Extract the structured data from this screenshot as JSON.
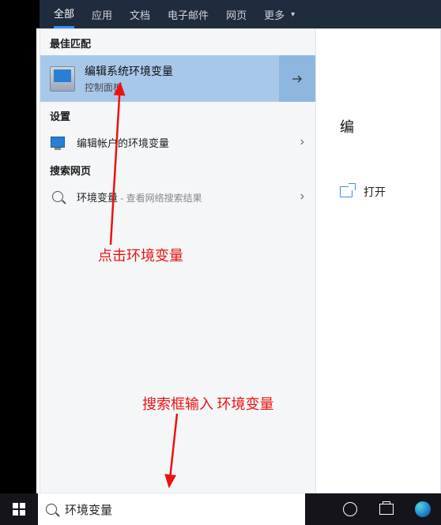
{
  "tabs": {
    "all": "全部",
    "apps": "应用",
    "docs": "文档",
    "email": "电子邮件",
    "web": "网页",
    "more": "更多"
  },
  "sections": {
    "best_match": "最佳匹配",
    "settings": "设置",
    "search_web": "搜索网页"
  },
  "best": {
    "title": "编辑系统环境变量",
    "subtitle": "控制面板"
  },
  "settings_item": {
    "label": "编辑帐户的环境变量"
  },
  "web_item": {
    "term": "环境变量",
    "hint": " - 查看网络搜索结果"
  },
  "preview": {
    "title_partial": "编",
    "open_label": "打开"
  },
  "annotations": {
    "click_env": "点击环境变量",
    "search_hint": "搜索框输入 环境变量"
  },
  "taskbar": {
    "search_value": "环境变量"
  }
}
